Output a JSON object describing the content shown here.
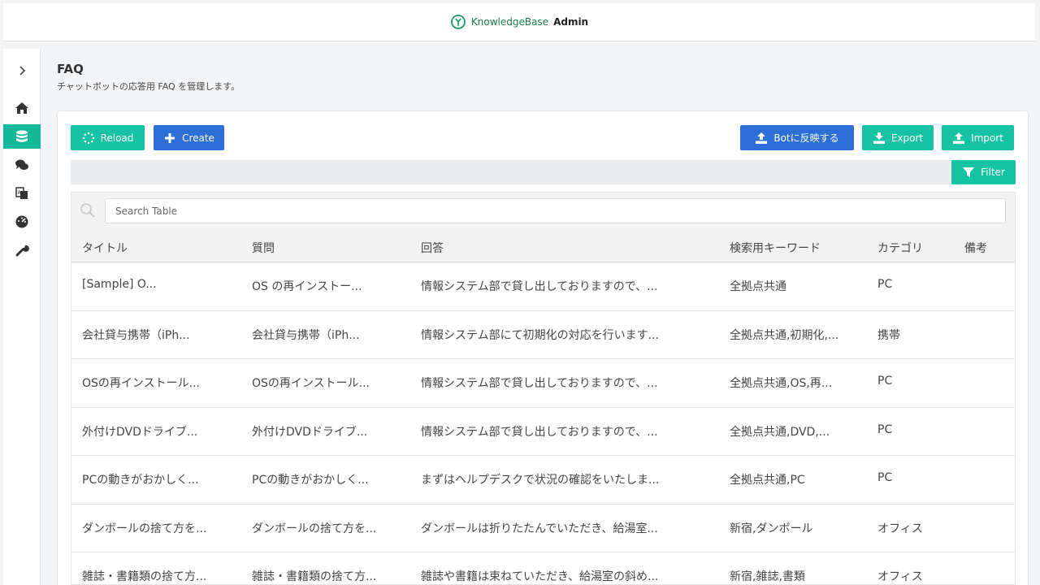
{
  "app": {
    "brand_light": "KnowledgeBase",
    "brand_bold": "Admin"
  },
  "sidebar": {
    "items": [
      {
        "icon": "chevron-right-icon"
      },
      {
        "icon": "home-icon"
      },
      {
        "icon": "database-icon",
        "active": true
      },
      {
        "icon": "chat-bubbles-icon"
      },
      {
        "icon": "translate-icon"
      },
      {
        "icon": "dashboard-gauge-icon"
      },
      {
        "icon": "wrench-icon"
      }
    ]
  },
  "page": {
    "title": "FAQ",
    "subtitle": "チャットボットの応答用 FAQ を管理します。"
  },
  "toolbar": {
    "reload_label": "Reload",
    "create_label": "Create",
    "reflect_label": "Botに反映する",
    "export_label": "Export",
    "import_label": "Import",
    "filter_label": "Filter"
  },
  "search": {
    "placeholder": "Search Table"
  },
  "table": {
    "columns": [
      "タイトル",
      "質問",
      "回答",
      "検索用キーワード",
      "カテゴリ",
      "備考"
    ],
    "rows": [
      [
        "[Sample] O...",
        "OS の再インストー...",
        "情報システム部で貸し出しておりますので、...",
        "全拠点共通",
        "PC",
        ""
      ],
      [
        "会社貸与携帯（iPh...",
        "会社貸与携帯（iPh...",
        "情報システム部にて初期化の対応を行います...",
        "全拠点共通,初期化,...",
        "携帯",
        ""
      ],
      [
        "OSの再インストール...",
        "OSの再インストール...",
        "情報システム部で貸し出しておりますので、...",
        "全拠点共通,OS,再...",
        "PC",
        ""
      ],
      [
        "外付けDVDドライブ...",
        "外付けDVDドライブ...",
        "情報システム部で貸し出しておりますので、...",
        "全拠点共通,DVD,...",
        "PC",
        ""
      ],
      [
        "PCの動きがおかしく...",
        "PCの動きがおかしく...",
        "まずはヘルプデスクで状況の確認をいたしま...",
        "全拠点共通,PC",
        "PC",
        ""
      ],
      [
        "ダンボールの捨て方を...",
        "ダンボールの捨て方を...",
        "ダンボールは折りたたんでいただき、給湯室...",
        "新宿,ダンボール",
        "オフィス",
        ""
      ],
      [
        "雑誌・書籍類の捨て方...",
        "雑誌・書籍類の捨て方...",
        "雑誌や書籍は束ねていただき、給湯室の斜め...",
        "新宿,雑誌,書類",
        "オフィス",
        ""
      ]
    ]
  },
  "colors": {
    "teal": "#16c2a4",
    "blue": "#2c6fd6",
    "active_sidebar": "#16b89a"
  }
}
